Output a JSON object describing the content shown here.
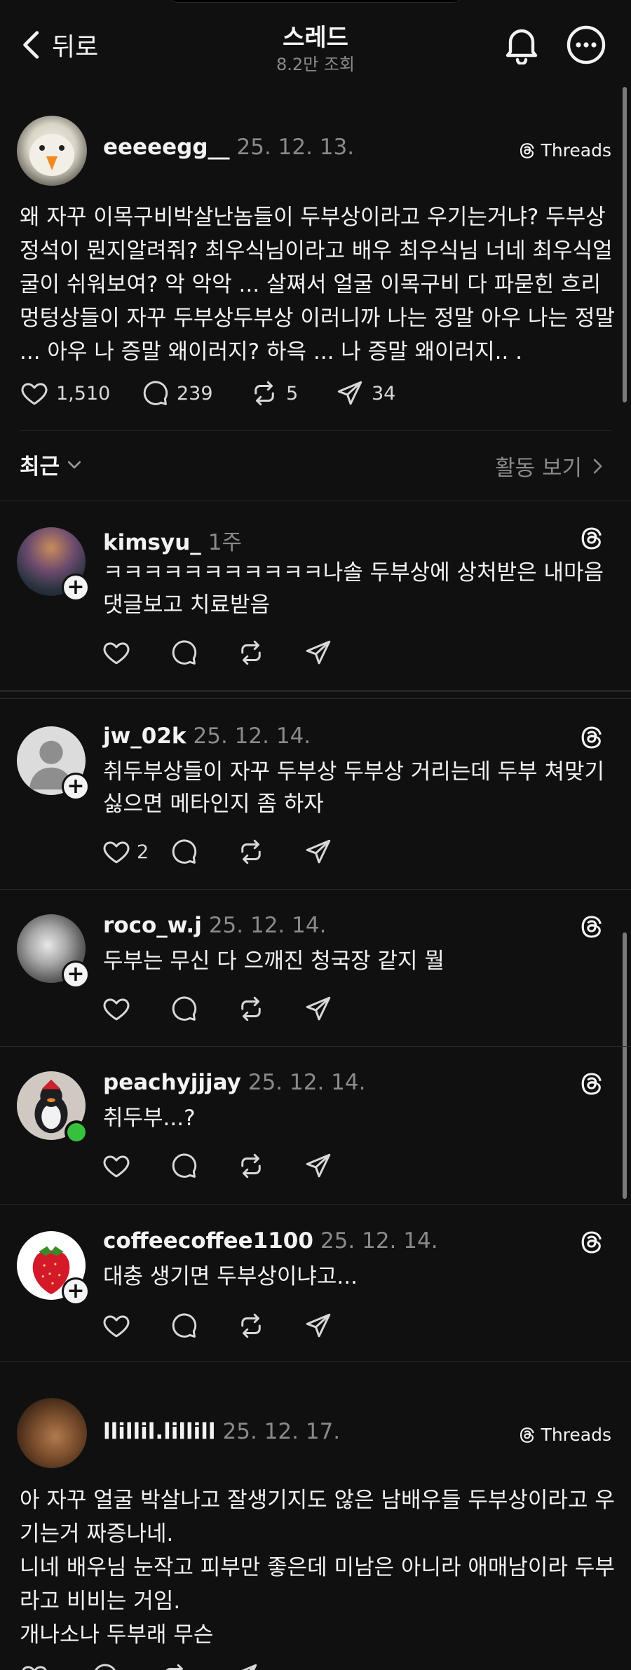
{
  "header": {
    "back_label": "뒤로",
    "title": "스레드",
    "subtitle": "8.2만 조회"
  },
  "main_post": {
    "username": "eeeeegg__",
    "date": "25. 12. 13.",
    "badge": "Threads",
    "text": "왜 자꾸 이목구비박살난놈들이 두부상이라고 우기는거냐? 두부상정석이 뭔지알려줘? 최우식님이라고 배우 최우식님 너네 최우식얼굴이 쉬워보여? 악 악악 ... 살쪄서 얼굴 이목구비 다 파묻힌 흐리멍텅상들이 자꾸 두부상두부상 이러니까 나는 정말 아우 나는 정말 ... 아우 나 증말 왜이러지? 하윽 ... 나 증말 왜이러지.. .",
    "likes": "1,510",
    "comments": "239",
    "reposts": "5",
    "shares": "34"
  },
  "sort": {
    "label": "최근",
    "activity": "활동 보기"
  },
  "replies": [
    {
      "username": "kimsyu_",
      "date": "1주",
      "text": "ㅋㅋㅋㅋㅋㅋㅋㅋㅋㅋㅋ나솔 두부상에 상처받은 내마음 댓글보고 치료받음",
      "likes": ""
    },
    {
      "username": "jw_02k",
      "date": "25. 12. 14.",
      "text": "취두부상들이 자꾸 두부상 두부상 거리는데 두부 쳐맞기 싫으면 메타인지 좀 하자",
      "likes": "2"
    },
    {
      "username": "roco_w.j",
      "date": "25. 12. 14.",
      "text": "두부는 무신 다 으깨진 청국장 같지 뭘",
      "likes": ""
    },
    {
      "username": "peachyjjjay",
      "date": "25. 12. 14.",
      "text": "취두부...?",
      "likes": ""
    },
    {
      "username": "coffeecoffee1100",
      "date": "25. 12. 14.",
      "text": "대충 생기면 두부상이냐고...",
      "likes": ""
    }
  ],
  "second_post": {
    "username": "llillil.lillill",
    "date": "25. 12. 17.",
    "badge": "Threads",
    "text": "아 자꾸 얼굴 박살나고 잘생기지도 않은 남배우들 두부상이라고 우기는거 짜증나네.\n니네 배우님 눈작고 피부만 좋은데 미남은 아니라 애매남이라 두부라고 비비는 거임.\n개나소나 두부래 무슨"
  }
}
